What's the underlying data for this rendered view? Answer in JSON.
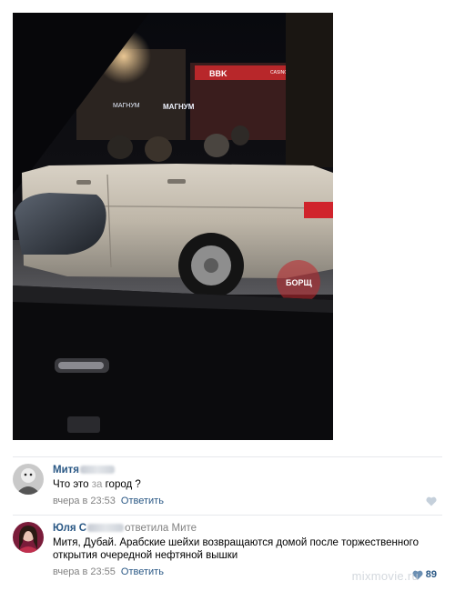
{
  "photo": {
    "store_sign": "МАГНУМ",
    "store_sign_left": "МАГНУМ",
    "bank_sign": "BBK",
    "watermark": "БОРЩ",
    "casino_sign": "CASINO"
  },
  "comments": [
    {
      "author": "Митя",
      "reply_to": "",
      "text_before": "Что это ",
      "text_blurred": "за",
      "text_after": " город ?",
      "time": "вчера в 23:53",
      "reply_label": "Ответить",
      "likes": ""
    },
    {
      "author": "Юля С",
      "reply_to": "ответила Мите",
      "text_line1": "Митя, Дубай. Арабские шейхи возвращаются домой после торжественного",
      "text_line2": "открытия очередной нефтяной вышки",
      "time": "вчера в 23:55",
      "reply_label": "Ответить",
      "likes": "89"
    }
  ],
  "site_watermark": "mixmovie.ru",
  "colors": {
    "link": "#2a5885",
    "meta": "#828282",
    "divider": "#e7e8ec"
  },
  "icons": [
    "heart-icon"
  ]
}
